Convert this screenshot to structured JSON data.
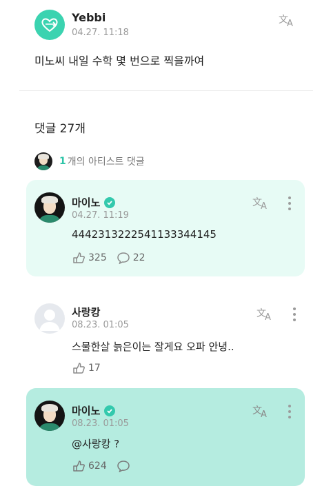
{
  "post": {
    "author": "Yebbi",
    "time": "04.27. 11:18",
    "text": "미노씨 내일 수학 몇 번으로 찍을까여"
  },
  "comments_section": {
    "title": "댓글 27개",
    "artist_count": "1",
    "artist_label": "개의 아티스트 댓글"
  },
  "comments": [
    {
      "author": "마이노",
      "time": "04.27. 11:19",
      "text": "4442313222541133344145",
      "likes": "325",
      "replies": "22"
    },
    {
      "author": "사랑캉",
      "time": "08.23. 01:05",
      "text": "스물한살 늙은이는 잘게요 오파 안녕..",
      "likes": "17"
    },
    {
      "author": "마이노",
      "time": "08.23. 01:05",
      "text": "@사랑캉 ?",
      "likes": "624",
      "replies": ""
    }
  ],
  "colors": {
    "accent": "#2ec4a8",
    "artist_card": "#e7fbf5",
    "artist_card_highlight": "#b5ece0"
  }
}
